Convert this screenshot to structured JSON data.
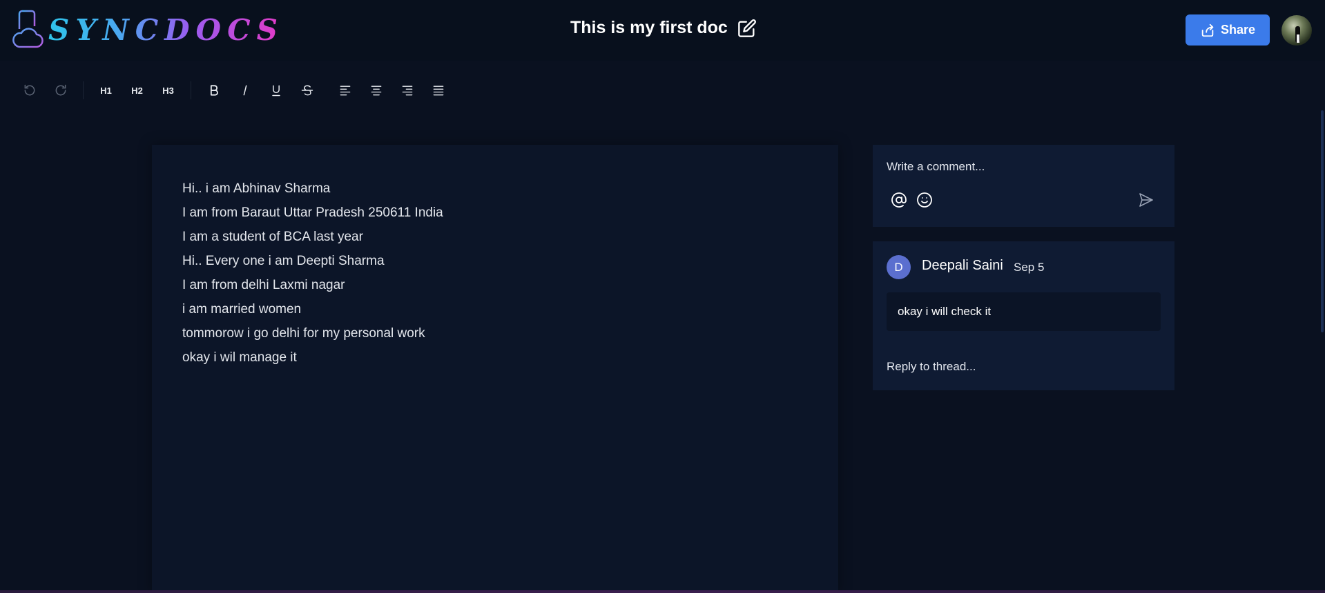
{
  "app": {
    "logo_text": "SYNCDOCS"
  },
  "header": {
    "doc_title": "This is my first doc",
    "share_label": "Share",
    "icons": [
      "cloud-doc-icon",
      "edit-icon",
      "share-icon"
    ]
  },
  "toolbar": {
    "heading_buttons": [
      "H1",
      "H2",
      "H3"
    ],
    "icons": [
      "undo-icon",
      "redo-icon",
      "bold-icon",
      "italic-icon",
      "underline-icon",
      "strikethrough-icon",
      "align-left-icon",
      "align-center-icon",
      "align-right-icon",
      "align-justify-icon"
    ]
  },
  "editor": {
    "lines": [
      "Hi.. i am Abhinav Sharma",
      "I am from Baraut Uttar Pradesh 250611 India",
      "I am a student of BCA last year",
      "Hi.. Every one i am Deepti Sharma",
      "I am from delhi Laxmi nagar",
      "i am married women",
      "tommorow i go delhi for my personal work",
      "okay i wil manage it"
    ]
  },
  "comments": {
    "composer_placeholder": "Write a comment...",
    "composer_icons": [
      "at-mention-icon",
      "emoji-icon",
      "send-icon"
    ],
    "thread": {
      "avatar_initial": "D",
      "author": "Deepali Saini",
      "date": "Sep 5",
      "body": "okay i will check it",
      "reply_placeholder": "Reply to thread..."
    }
  },
  "colors": {
    "background": "#0a1120",
    "panel": "#0f1b33",
    "editor": "#0c1528",
    "accent": "#3b7bea",
    "avatar": "#5b6fcf"
  }
}
